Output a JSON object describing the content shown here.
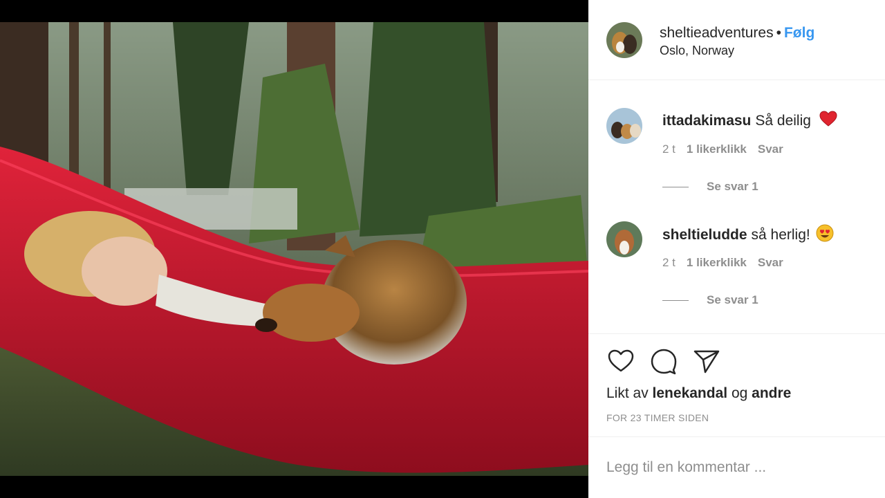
{
  "post": {
    "username": "sheltieadventures",
    "separator": "•",
    "follow_label": "Følg",
    "location": "Oslo, Norway",
    "photo_description_icon": "post-photo"
  },
  "comments": [
    {
      "username": "ittadakimasu",
      "text": "Så deilig",
      "emoji": "heart-eyes-red-heart",
      "time": "2 t",
      "likes": "1 likerklikk",
      "reply": "Svar",
      "view_replies": "Se svar 1"
    },
    {
      "username": "sheltieludde",
      "text": "så herlig!",
      "emoji": "smiling-face-heart-eyes",
      "time": "2 t",
      "likes": "1 likerklikk",
      "reply": "Svar",
      "view_replies": "Se svar 1"
    }
  ],
  "actions": {
    "like_icon": "heart-outline-icon",
    "comment_icon": "speech-bubble-icon",
    "share_icon": "paper-plane-icon"
  },
  "likes": {
    "prefix": "Likt av",
    "user": "lenekandal",
    "conjunction": "og",
    "others": "andre"
  },
  "timestamp": "FOR 23 TIMER SIDEN",
  "add_comment_placeholder": "Legg til en kommentar ...",
  "colors": {
    "follow": "#3897f0",
    "secondary_text": "#8e8e8e",
    "hammock": "#c8142a"
  }
}
